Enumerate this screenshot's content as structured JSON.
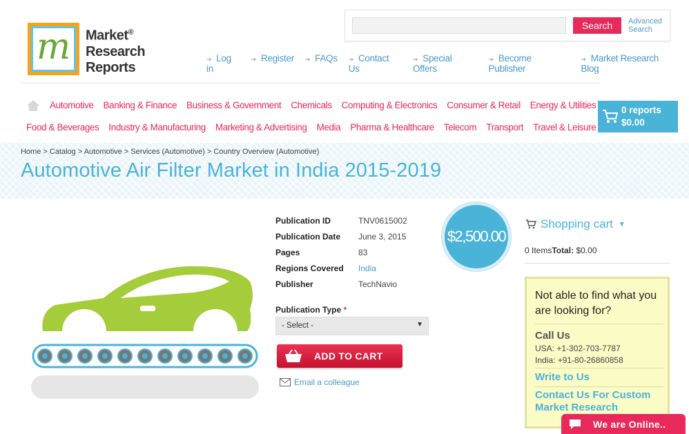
{
  "logo": {
    "mark": "m",
    "line1": "Market",
    "line2": "Research",
    "line3": "Reports",
    "reg": "®"
  },
  "search": {
    "placeholder": "",
    "button": "Search",
    "advanced_line1": "Advanced",
    "advanced_line2": "Search"
  },
  "top_links": [
    "Log in",
    "Register",
    "FAQs",
    "Contact Us",
    "Special Offers",
    "Become Publisher",
    "Market Research Blog"
  ],
  "categories_row1": [
    "Automotive",
    "Banking & Finance",
    "Business & Government",
    "Chemicals",
    "Computing & Electronics",
    "Consumer & Retail",
    "Energy & Utilities"
  ],
  "categories_row2": [
    "Food & Beverages",
    "Industry & Manufacturing",
    "Marketing & Advertising",
    "Media",
    "Pharma & Healthcare",
    "Telecom",
    "Transport",
    "Travel & Leisure"
  ],
  "cart_top": {
    "count": "0 reports",
    "total": "$0.00"
  },
  "breadcrumb": "Home > Catalog > Automotive > Services (Automotive) > Country Overview (Automotive)",
  "title": "Automotive Air Filter Market in India 2015-2019",
  "details": [
    {
      "key": "Publication ID",
      "value": "TNV0615002"
    },
    {
      "key": "Publication Date",
      "value": "June 3, 2015"
    },
    {
      "key": "Pages",
      "value": "83"
    },
    {
      "key": "Regions Covered",
      "value": "India"
    },
    {
      "key": "Publisher",
      "value": "TechNavio"
    }
  ],
  "publication_type": {
    "label": "Publication Type",
    "required": "*",
    "selected": "- Select -"
  },
  "add_to_cart": "ADD TO CART",
  "email_colleague": "Email a colleague",
  "price": "$2,500.00",
  "shopping_cart": {
    "title": "Shopping cart",
    "items": "0 Items",
    "total_label": "Total:",
    "total_value": "$0.00"
  },
  "help": {
    "question": "Not able to find what you are looking for?",
    "call_us": "Call Us",
    "usa": "USA: +1-302-703-7787",
    "india": "India: +91-80-26860858",
    "write_to_us": "Write to Us",
    "custom_line1": "Contact Us For Custom",
    "custom_line2": "Market Research"
  },
  "chat": "We are Online..",
  "colors": {
    "accent_pink": "#e8295c",
    "accent_blue": "#4ab3d8",
    "car_green": "#a5cc3a"
  }
}
